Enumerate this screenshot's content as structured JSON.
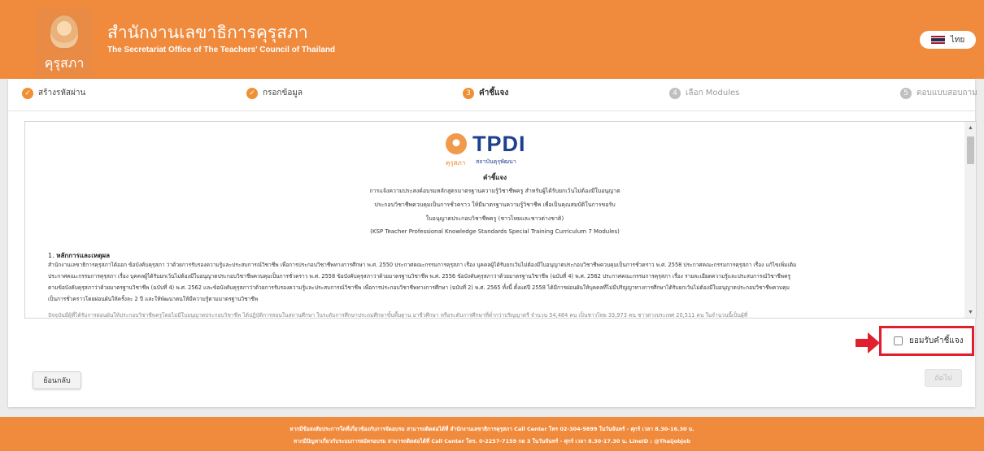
{
  "header": {
    "logo_text": "คุรุสภา",
    "org_name_th": "สำนักงานเลขาธิการคุรุสภา",
    "org_name_en": "The Secretariat Office of The Teachers' Council of Thailand",
    "language_label": "ไทย",
    "flag_colors": [
      "#a51931",
      "#f4f5f8",
      "#2d2a4a",
      "#f4f5f8",
      "#a51931"
    ]
  },
  "stepper": {
    "steps": [
      {
        "number": "1",
        "label": "สร้างรหัสผ่าน",
        "state": "done"
      },
      {
        "number": "2",
        "label": "กรอกข้อมูล",
        "state": "done"
      },
      {
        "number": "3",
        "label": "คำชี้แจง",
        "state": "current"
      },
      {
        "number": "4",
        "label": "เลือก Modules",
        "state": "todo"
      },
      {
        "number": "5",
        "label": "ตอบแบบสอบถาม",
        "state": "todo"
      }
    ]
  },
  "document": {
    "logo_mark": "TPDI",
    "logo_sub_a": "คุรุสภา",
    "logo_sub_b": "สถาบันคุรุพัฒนา",
    "title": "คำชี้แจง",
    "center_lines": [
      "การแจ้งความประสงค์อบรมหลักสูตรมาตรฐานความรู้วิชาชีพครู สำหรับผู้ได้รับยกเว้นไม่ต้องมีใบอนุญาต",
      "ประกอบวิชาชีพควบคุมเป็นการชั่วคราว ให้มีมาตรฐานความรู้วิชาชีพ เพื่อเป็นคุณสมบัติในการขอรับ",
      "ใบอนุญาตประกอบวิชาชีพครู (ชาวไทยและชาวต่างชาติ)",
      "(KSP Teacher Professional Knowledge Standards Special Training Curriculum 7 Modules)"
    ],
    "section_number": "1.",
    "section_title": "หลักการและเหตุผล",
    "paragraph_lines": [
      "สำนักงานเลขาธิการคุรุสภาได้ออก ข้อบังคับคุรุสภา ว่าด้วยการรับรองความรู้และประสบการณ์วิชาชีพ เพื่อการประกอบวิชาชีพทางการศึกษา พ.ศ. 2550 ประกาศคณะกรรมการคุรุสภา เรื่อง บุคคลผู้ได้รับยกเว้นไม่ต้องมีใบอนุญาตประกอบวิชาชีพควบคุมเป็นการชั่วคราว พ.ศ. 2558 ประกาศคณะกรรมการคุรุสภา เรื่อง แก้ไขเพิ่มเติม",
      "ประกาศคณะกรรมการคุรุสภา เรื่อง บุคคลผู้ได้รับยกเว้นไม่ต้องมีใบอนุญาตประกอบวิชาชีพควบคุมเป็นการชั่วคราว พ.ศ. 2558 ข้อบังคับคุรุสภาว่าด้วยมาตรฐานวิชาชีพ พ.ศ. 2556 ข้อบังคับคุรุสภาว่าด้วยมาตรฐานวิชาชีพ (ฉบับที่ 4) พ.ศ. 2562 ประกาศคณะกรรมการคุรุสภา เรื่อง รายละเอียดความรู้และประสบการณ์วิชาชีพครู",
      "ตามข้อบังคับคุรุสภาว่าด้วยมาตรฐานวิชาชีพ (ฉบับที่ 4) พ.ศ. 2562 และข้อบังคับคุรุสภาว่าด้วยการรับรองความรู้และประสบการณ์วิชาชีพ เพื่อการประกอบวิชาชีพทางการศึกษา (ฉบับที่ 2) พ.ศ. 2565 ทั้งนี้ ตั้งแต่ปี 2558 ได้มีการผ่อนผันให้บุคคลที่ไม่มีปริญญาทางการศึกษาได้รับยกเว้นไม่ต้องมีใบอนุญาตประกอบวิชาชีพควบคุม",
      "เป็นการชั่วคราวโดยผ่อนผันให้ครั้งละ 2 ปี และให้พัฒนาตนให้มีความรู้ตามมาตรฐานวิชาชีพ",
      "ปัจจุบันมีผู้ที่ได้รับการผ่อนผันให้ประกอบวิชาชีพครูโดยไม่มีใบอนุญาตประกอบวิชาชีพ ได้ปฏิบัติการสอนในสถานศึกษา ในระดับการศึกษาประถมศึกษาขั้นพื้นฐาน อาชีวศึกษา หรือระดับการศึกษาที่ต่ำกว่าปริญญาตรี จำนวน 54,484 คน เป็นชาวไทย 33,973 คน ชาวต่างประเทศ 20,511 คน ในจำนวนนี้เป็นผู้ที่"
    ]
  },
  "accept": {
    "label": "ยอมรับคำชี้แจง",
    "checked": false,
    "highlight_color": "#e0202e"
  },
  "actions": {
    "back_label": "ย้อนกลับ",
    "next_label": "ถัดไป"
  },
  "footer": {
    "line1": "หากมีข้อสงสัยประการใดที่เกี่ยวข้องกับการจัดอบรม สามารถติดต่อได้ที่ สำนักงานเลขาธิการคุรุสภา Call Center โทร 02-304-9899 ในวันจันทร์ - ศุกร์ เวลา 8.30-16.30 น.",
    "line2": "หากมีปัญหาเกี่ยวกับระบบการสมัครอบรม สามารถติดต่อได้ที่ Call Center โทร. 0-2257-7159 กด 3 ในวันจันทร์ - ศุกร์ เวลา 8.30-17.30 น. LineID : @Thaijobjob"
  },
  "colors": {
    "brand_orange": "#f08a3c",
    "step_done": "#f09035",
    "step_todo": "#bfbfbf"
  }
}
